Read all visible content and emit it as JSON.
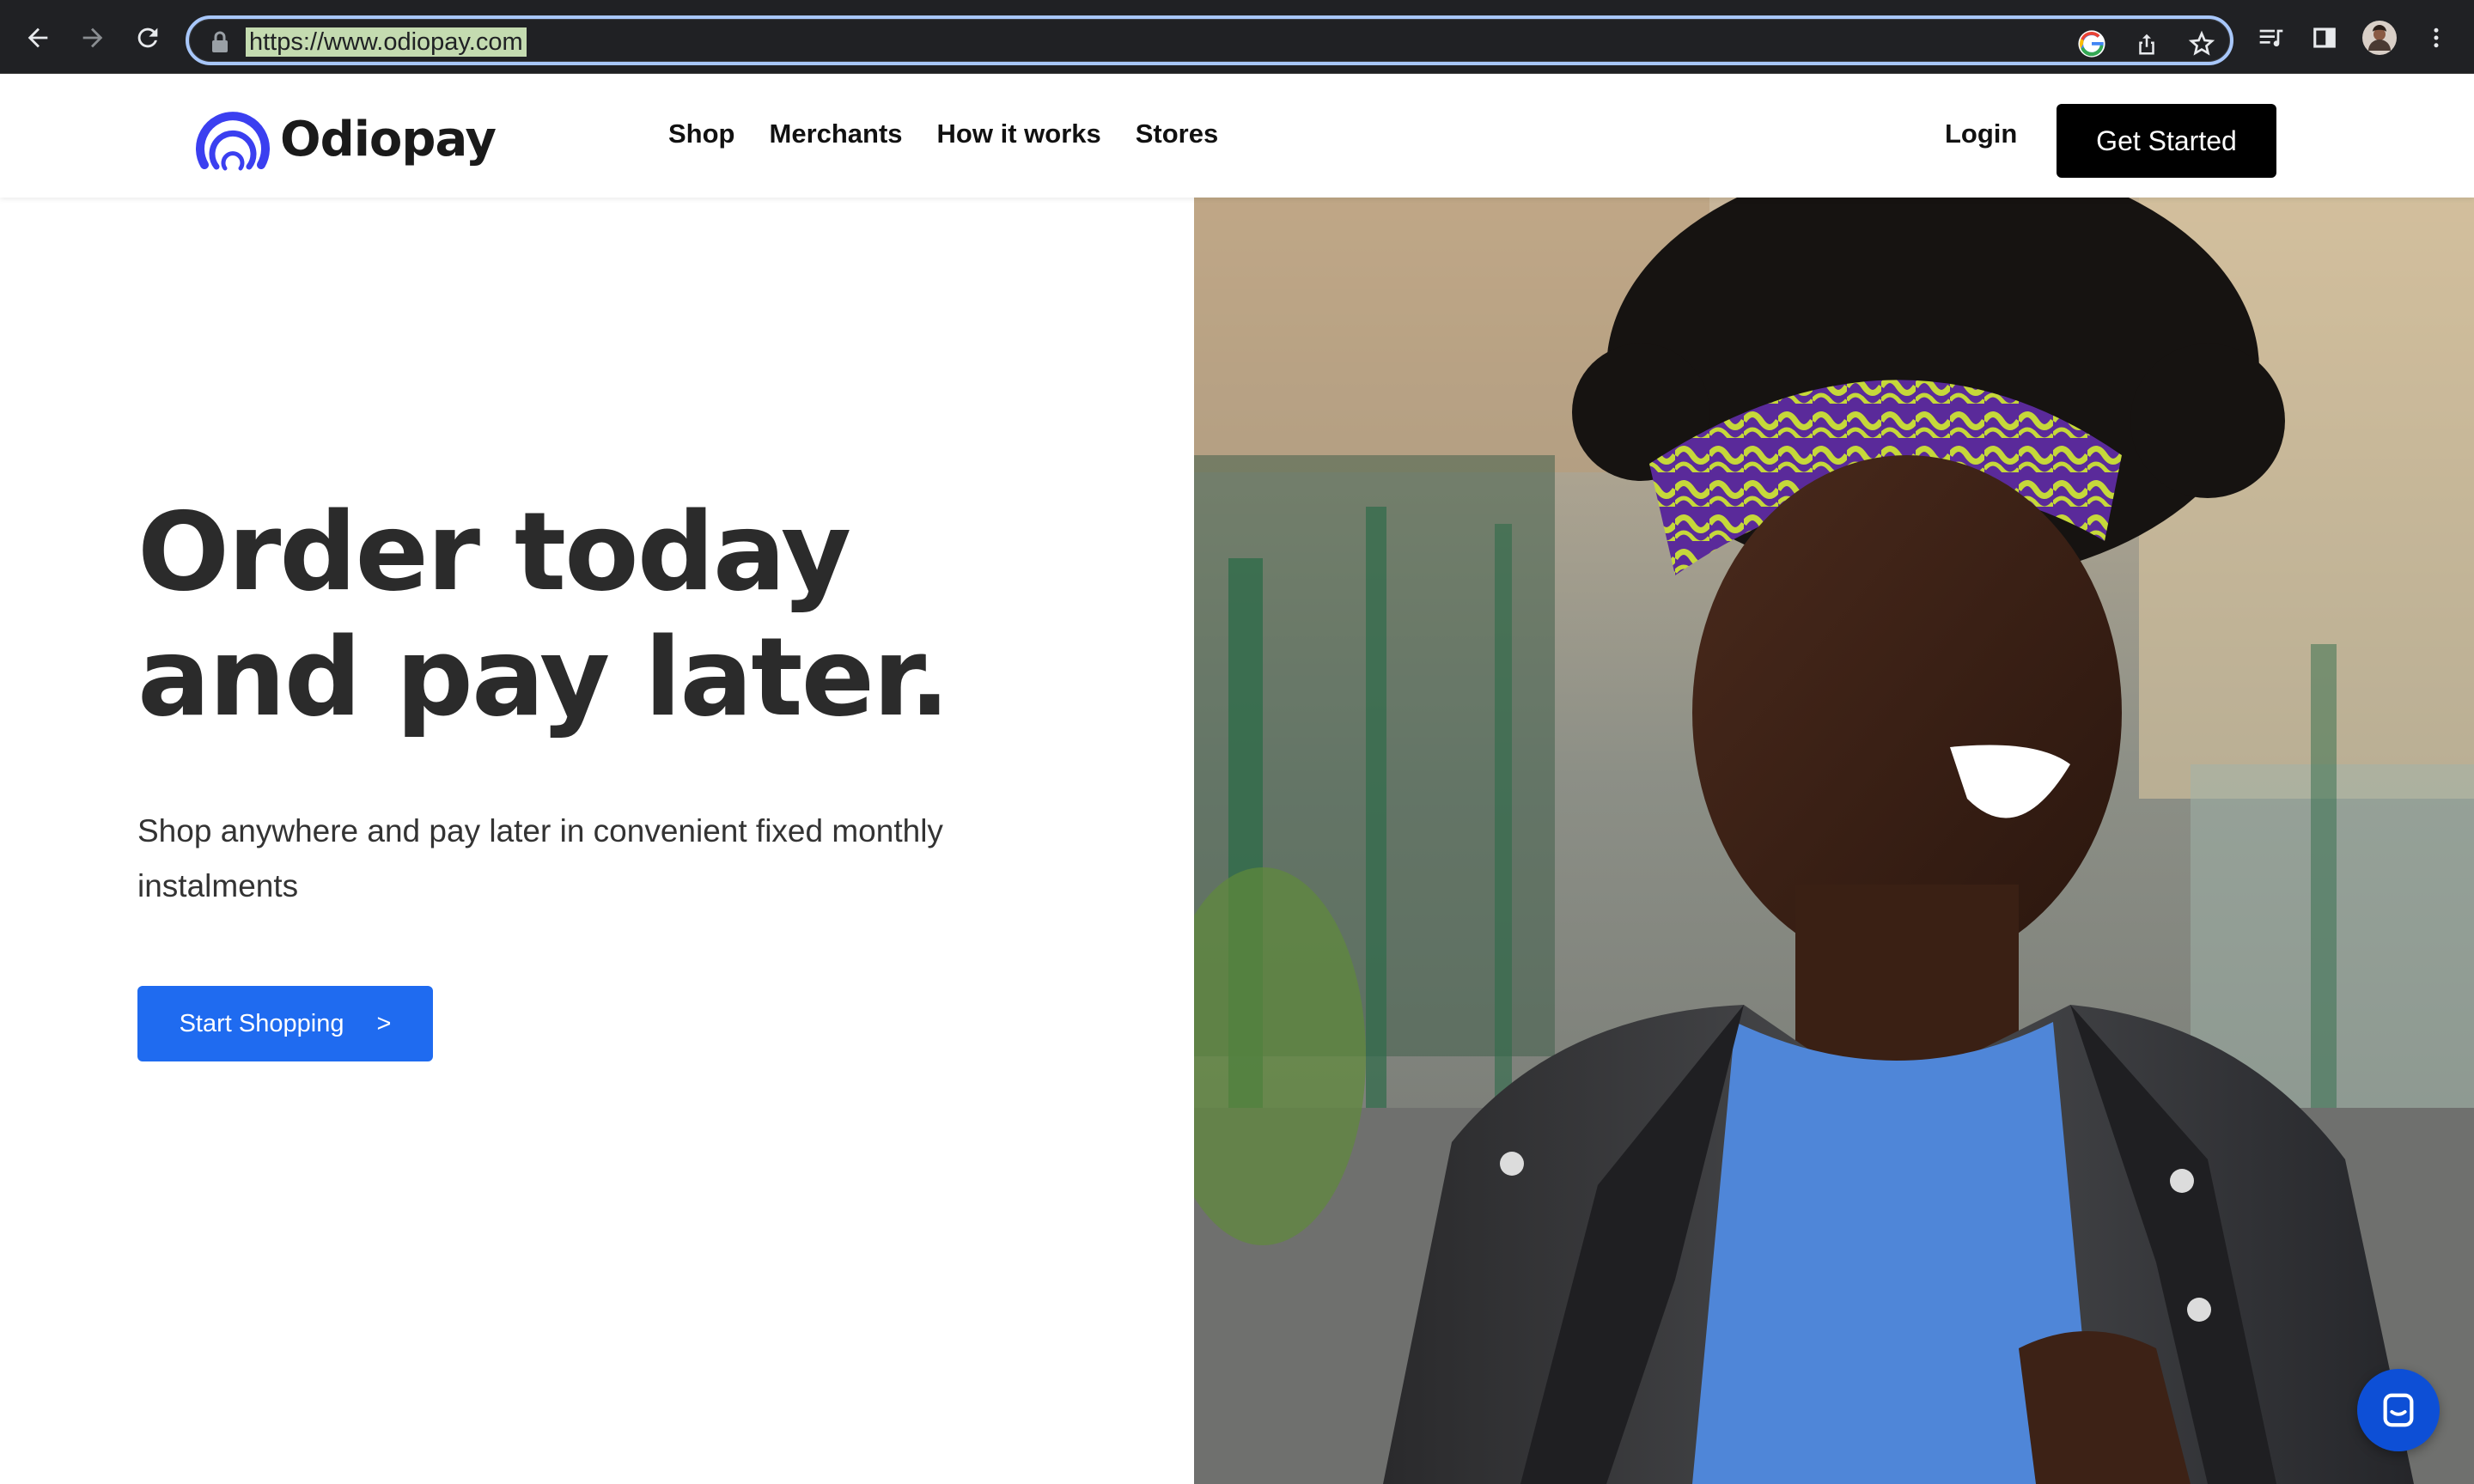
{
  "browser": {
    "url": "https://www.odiopay.com"
  },
  "header": {
    "brand": "Odiopay",
    "nav": [
      "Shop",
      "Merchants",
      "How it works",
      "Stores"
    ],
    "login_label": "Login",
    "cta_label": "Get Started"
  },
  "hero": {
    "title_line1": "Order today",
    "title_line2": "and pay later.",
    "subtitle": "Shop anywhere and pay later in convenient fixed monthly instalments",
    "button_label": "Start Shopping",
    "button_arrow": ">"
  },
  "colors": {
    "brand_blue": "#1f6bf0",
    "logo_blue": "#3b3ff0",
    "chat_blue": "#0d4fd6",
    "heading": "#2b2b2b",
    "cta_black": "#000000"
  },
  "icons": {
    "back": "arrow-left-icon",
    "forward": "arrow-right-icon",
    "reload": "reload-icon",
    "lock": "lock-icon",
    "google": "google-icon",
    "share": "share-icon",
    "bookmark": "star-icon",
    "reading_list": "reading-list-icon",
    "side_panel": "side-panel-icon",
    "profile": "avatar",
    "menu": "kebab-menu-icon",
    "chat": "chat-icon"
  }
}
